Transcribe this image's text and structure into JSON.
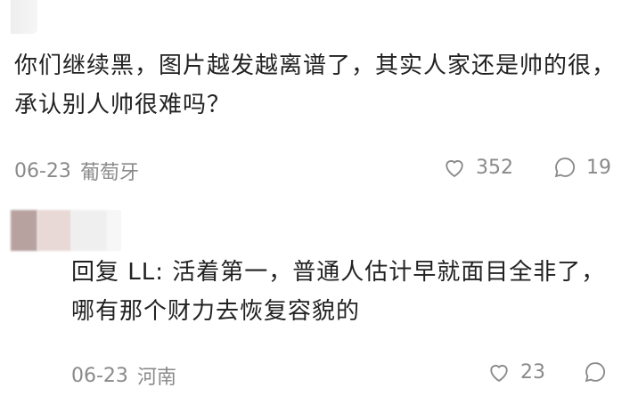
{
  "comment": {
    "text": "你们继续黑，图片越发越离谱了，其实人家还是帅的很，承认别人帅很难吗？",
    "date": "06-23",
    "location": "葡萄牙",
    "likes": "352",
    "replies": "19"
  },
  "reply": {
    "prefix": "回复 LL:",
    "text": " 活着第一，普通人估计早就面目全非了，哪有那个财力去恢复容貌的",
    "date": "06-23",
    "location": "河南",
    "likes": "23"
  },
  "icons": {
    "like": "heart-outline-icon",
    "comment": "speech-bubble-icon"
  },
  "colors": {
    "text": "#222222",
    "meta": "#8a8a8a",
    "background": "#ffffff"
  }
}
